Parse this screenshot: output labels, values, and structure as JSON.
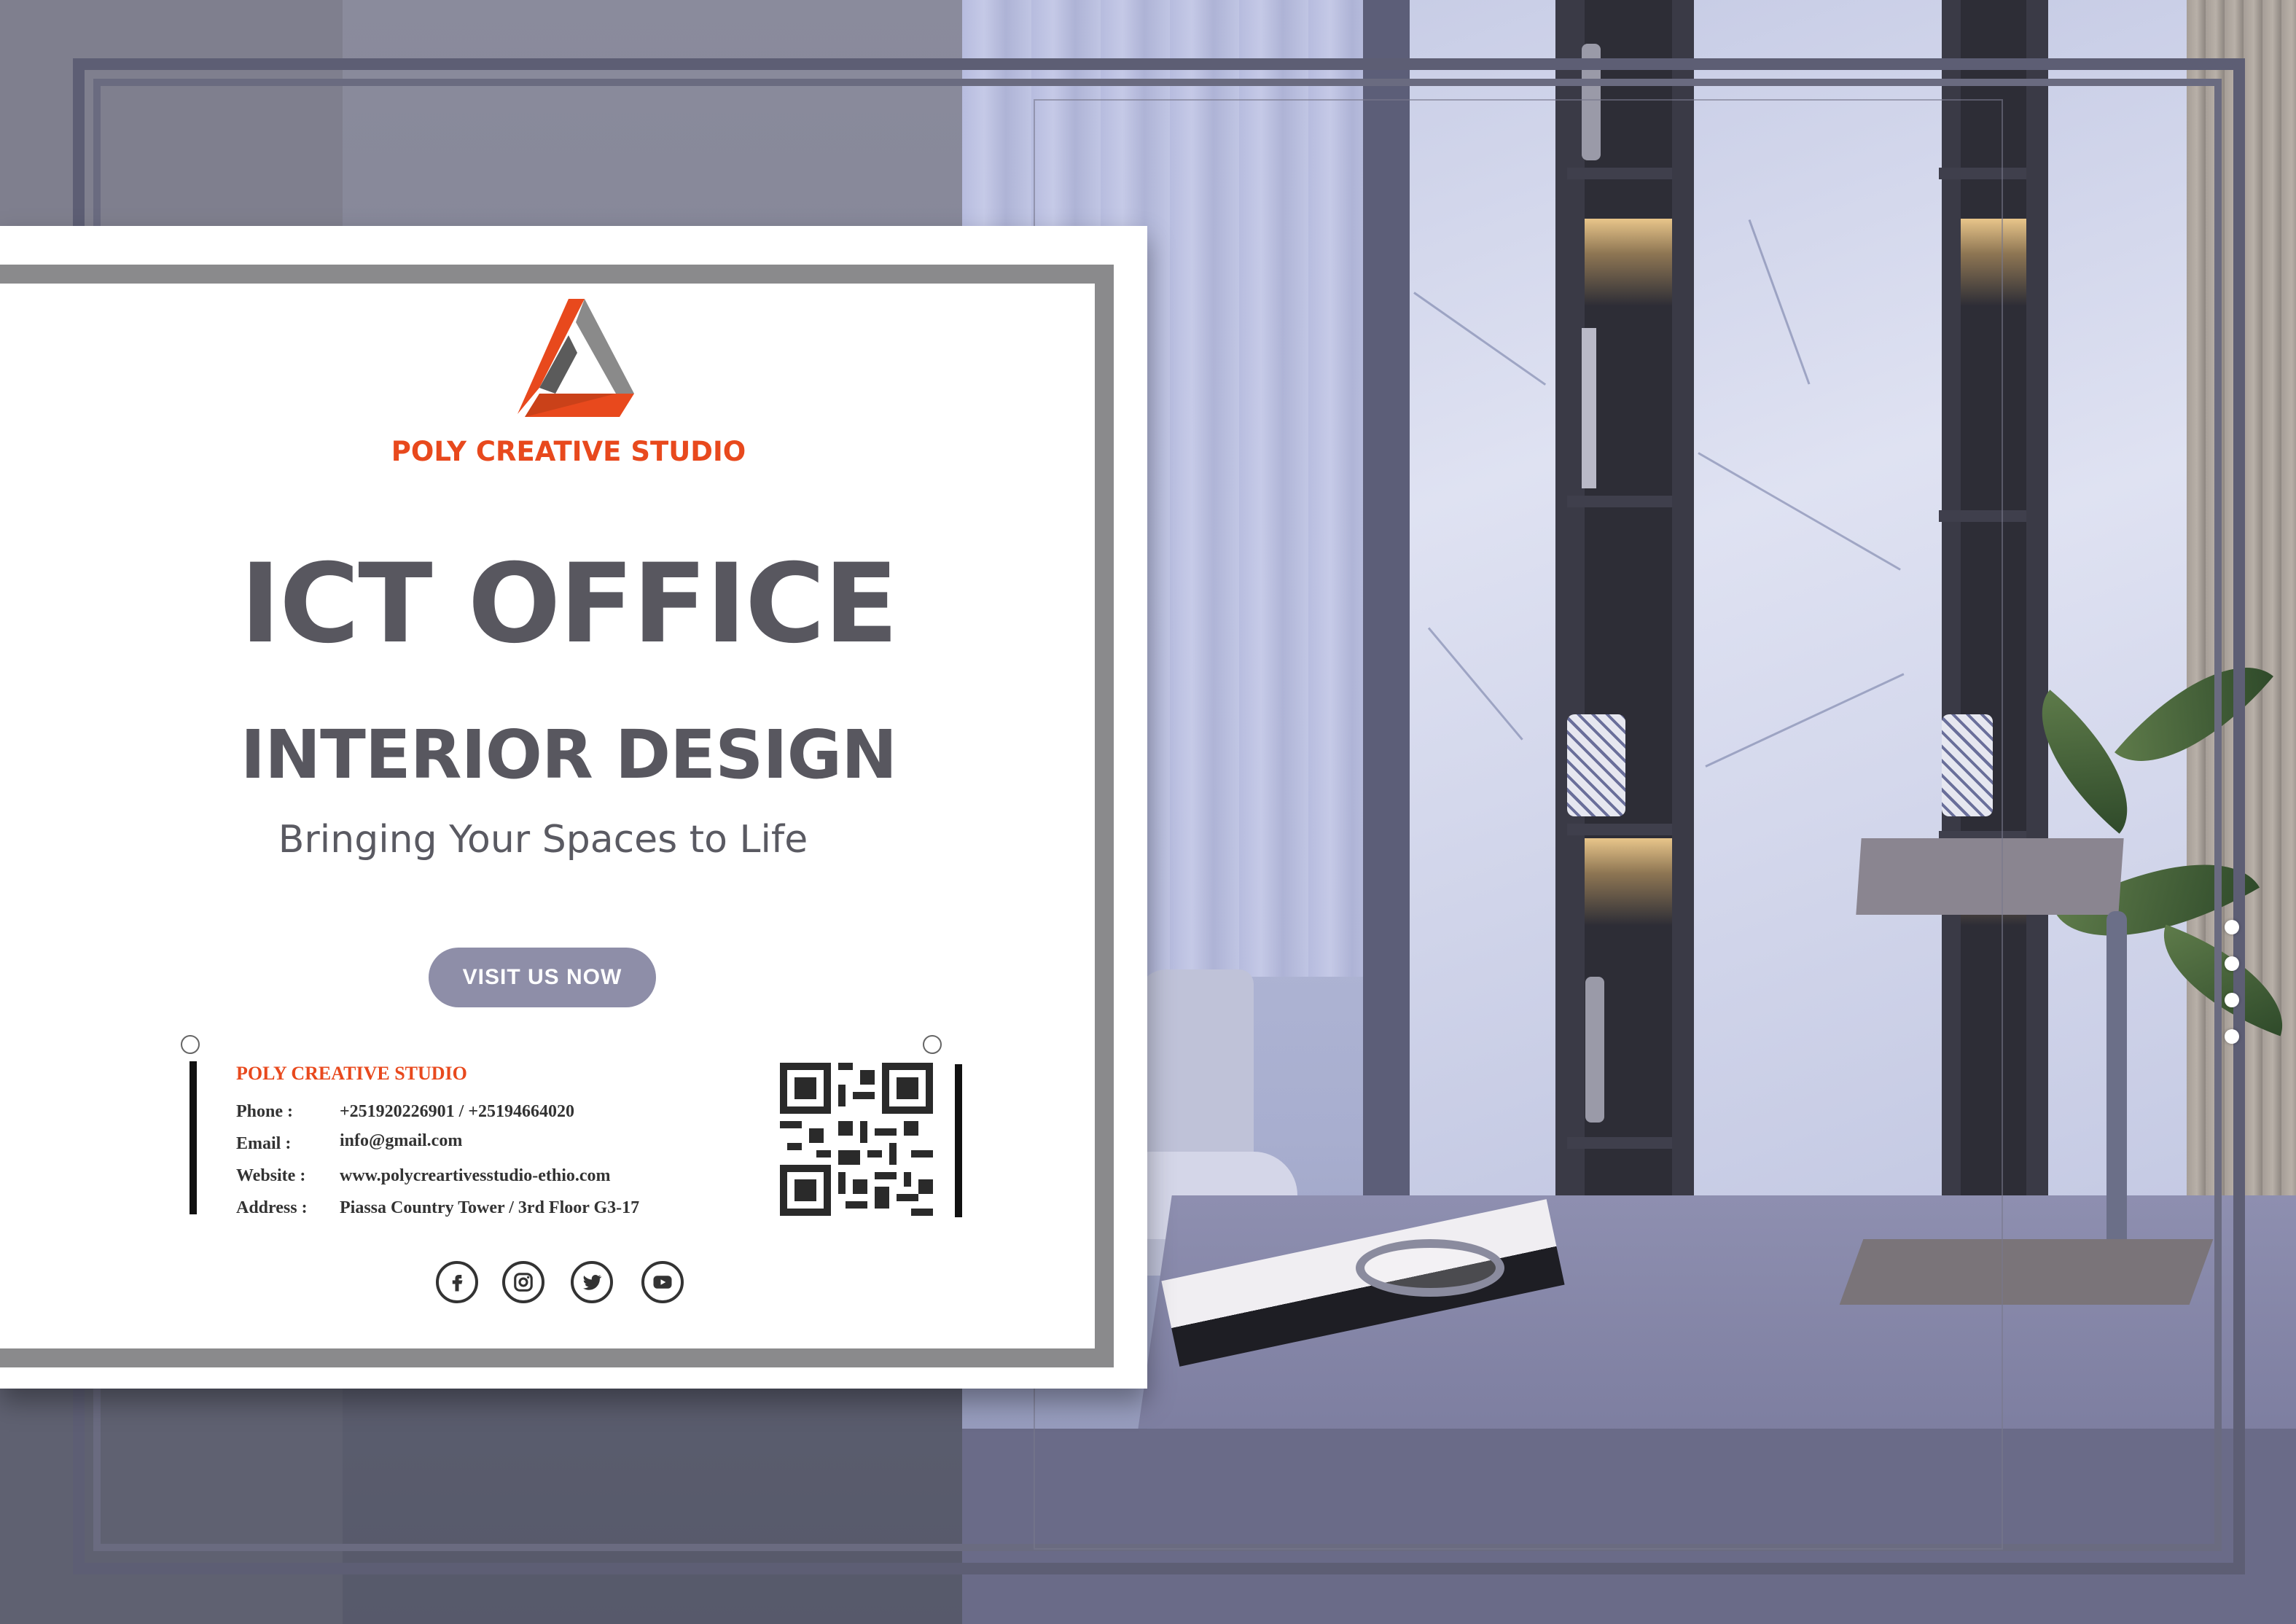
{
  "brand": {
    "name": "POLY CREATIVE STUDIO",
    "accent_color": "#e8491d",
    "logo_icon": "triangle-logo-icon"
  },
  "hero": {
    "title": "ICT OFFICE",
    "subtitle": "INTERIOR DESIGN",
    "tagline": "Bringing Your Spaces to Life",
    "cta_label": "VISIT US NOW"
  },
  "contact": {
    "heading": "POLY CREATIVE STUDIO",
    "rows": [
      {
        "label": "Phone :",
        "value": "+251920226901 / +25194664020"
      },
      {
        "label": "Email :",
        "value": "info@gmail.com"
      },
      {
        "label": "Website :",
        "value": "www.polycreartivesstudio-ethio.com"
      },
      {
        "label": "Address :",
        "value": "Piassa Country Tower / 3rd Floor G3-17"
      }
    ],
    "qr_icon": "qr-code-icon"
  },
  "social": [
    {
      "name": "facebook-icon"
    },
    {
      "name": "instagram-icon"
    },
    {
      "name": "twitter-icon"
    },
    {
      "name": "youtube-icon"
    }
  ],
  "pagination": {
    "dot_count": 4
  }
}
